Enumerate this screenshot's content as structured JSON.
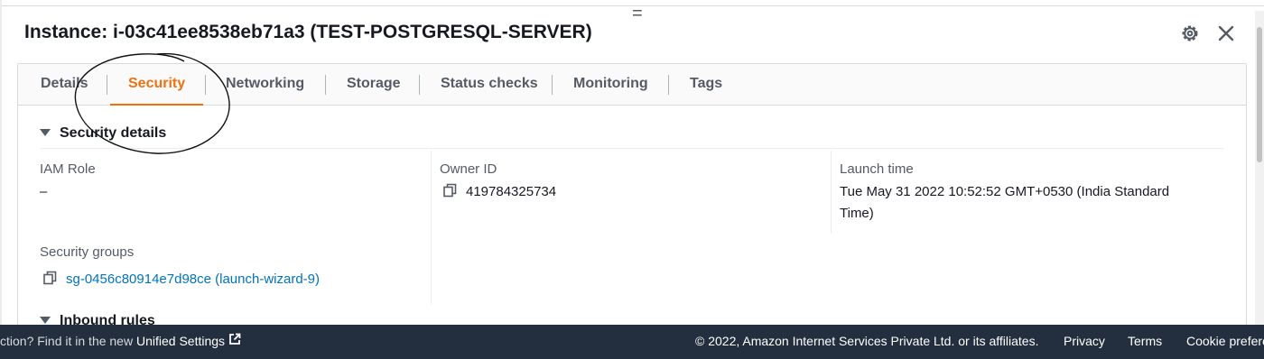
{
  "window": {
    "title": "Instance: i-03c41ee8538eb71a3 (TEST-POSTGRESQL-SERVER)",
    "resize_glyph": "="
  },
  "header": {
    "settings_icon": "gear-icon",
    "close_icon": "close-icon"
  },
  "tabs": [
    {
      "label": "Details",
      "active": false
    },
    {
      "label": "Security",
      "active": true
    },
    {
      "label": "Networking",
      "active": false
    },
    {
      "label": "Storage",
      "active": false
    },
    {
      "label": "Status checks",
      "active": false
    },
    {
      "label": "Monitoring",
      "active": false
    },
    {
      "label": "Tags",
      "active": false
    }
  ],
  "security_details": {
    "heading": "Security details",
    "iam_role": {
      "label": "IAM Role",
      "value": "–"
    },
    "owner_id": {
      "label": "Owner ID",
      "value": "419784325734"
    },
    "launch_time": {
      "label": "Launch time",
      "value": "Tue May 31 2022 10:52:52 GMT+0530 (India Standard Time)"
    },
    "security_groups": {
      "label": "Security groups",
      "value": "sg-0456c80914e7d98ce (launch-wizard-9)"
    }
  },
  "inbound_rules": {
    "heading": "Inbound rules"
  },
  "footer": {
    "prefix": "ction? Find it in the new ",
    "unified_settings": "Unified Settings",
    "copyright": "© 2022, Amazon Internet Services Private Ltd. or its affiliates.",
    "privacy": "Privacy",
    "terms": "Terms",
    "cookie": "Cookie prefere"
  },
  "colors": {
    "accent": "#ec7211",
    "link": "#0073bb",
    "footer_bg": "#232f3e"
  }
}
